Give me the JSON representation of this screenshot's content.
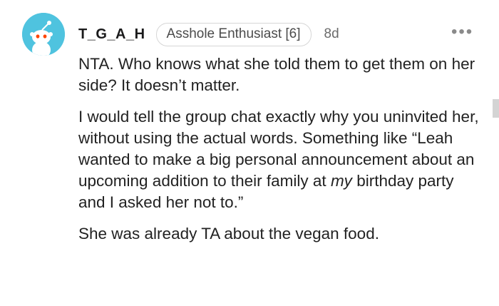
{
  "comment": {
    "username": "T_G_A_H",
    "flair": "Asshole Enthusiast [6]",
    "age": "8d",
    "more_glyph": "•••",
    "avatar_icon": "snoo-avatar-icon",
    "paragraphs": {
      "p1": "NTA. Who knows what she told them to get them on her side? It doesn’t matter.",
      "p2_before": "I would tell the group chat exactly why you uninvited her, without using the actual words. Something like “Leah wanted to make a big personal announcement about an upcoming addition to their family at ",
      "p2_em": "my",
      "p2_after": " birthday party and I asked her not to.”",
      "p3": "She was already TA about the vegan food."
    }
  },
  "colors": {
    "avatar_bg": "#4fc3df",
    "text": "#222222",
    "meta": "#6b6b6b"
  }
}
